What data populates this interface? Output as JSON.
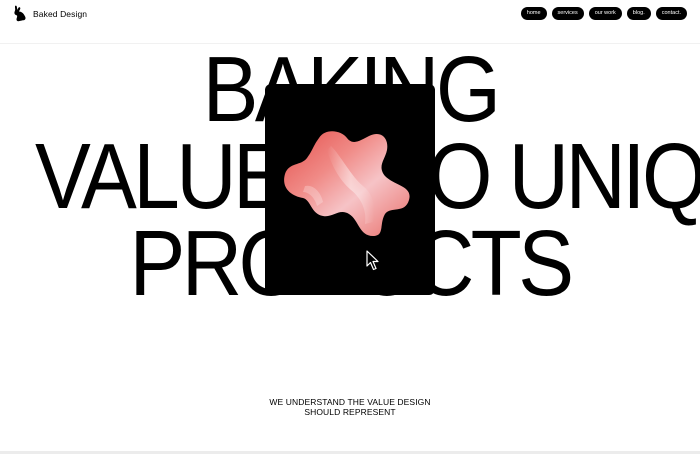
{
  "brand": {
    "name": "Baked Design",
    "logo_icon": "rabbit-silhouette-icon"
  },
  "nav": {
    "items": [
      {
        "label": "home"
      },
      {
        "label": "services"
      },
      {
        "label": "our work"
      },
      {
        "label": "blog."
      },
      {
        "label": "contact."
      }
    ]
  },
  "hero": {
    "lines": [
      "BAKING",
      "VALUE INTO UNIQUE",
      "PRODUCTS"
    ],
    "card_icon": "pink-blob-image",
    "cursor_icon": "mouse-pointer-icon"
  },
  "tagline": {
    "line1": "WE UNDERSTAND THE VALUE DESIGN",
    "line2": "SHOULD REPRESENT"
  },
  "colors": {
    "background": "#ffffff",
    "text": "#000000",
    "nav_pill": "#000000",
    "nav_text": "#ffffff",
    "blob": "#e86a62"
  }
}
